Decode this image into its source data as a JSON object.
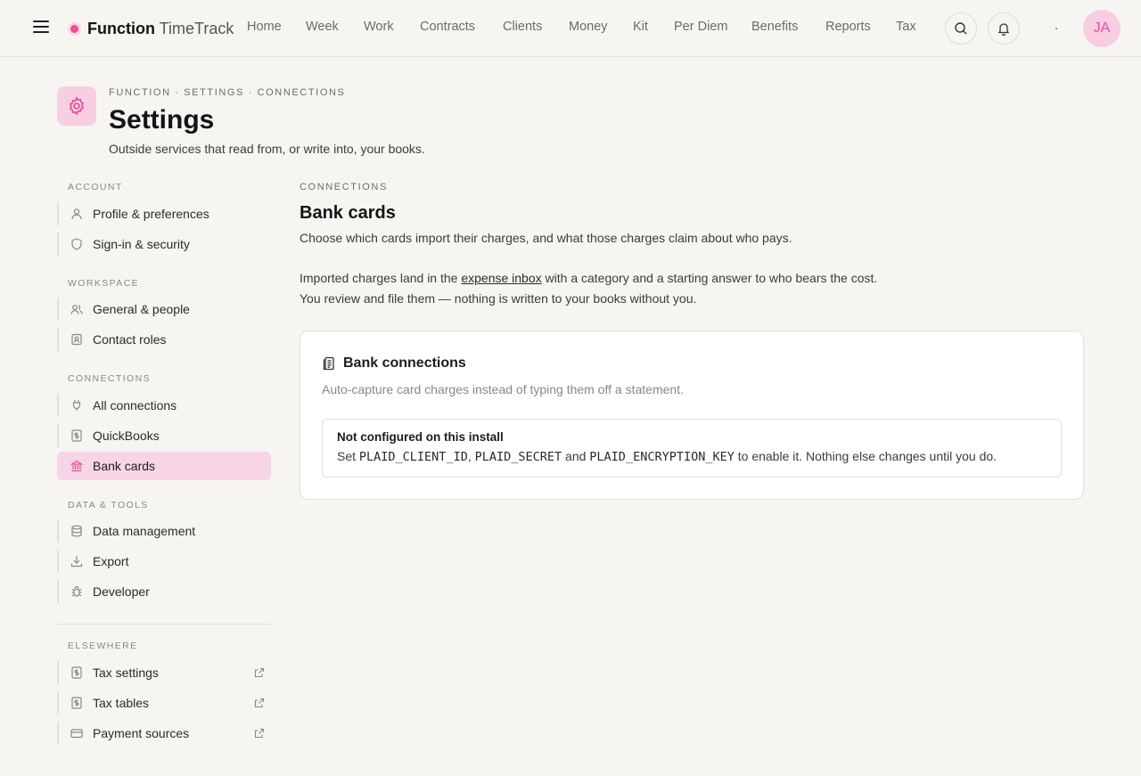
{
  "brand": {
    "name": "Function",
    "product": "TimeTrack",
    "accent": "#ec4f9a"
  },
  "nav": [
    "Home",
    "Week",
    "Work",
    "Contracts",
    "Clients",
    "Money",
    "Kit",
    "Per Diem",
    "Benefits",
    "Reports",
    "Tax"
  ],
  "topbar": {
    "search_icon": "search-icon",
    "bell_icon": "bell-icon",
    "avatar_initials": "JA"
  },
  "header": {
    "breadcrumb": "FUNCTION · SETTINGS · CONNECTIONS",
    "title": "Settings",
    "subtitle": "Outside services that read from, or write into, your books.",
    "icon": "gear-icon"
  },
  "sidebar": {
    "sections": [
      {
        "label": "ACCOUNT",
        "items": [
          {
            "label": "Profile & preferences",
            "icon": "user-icon"
          },
          {
            "label": "Sign-in & security",
            "icon": "shield-icon"
          }
        ]
      },
      {
        "label": "WORKSPACE",
        "items": [
          {
            "label": "General & people",
            "icon": "users-icon"
          },
          {
            "label": "Contact roles",
            "icon": "contact-card-icon"
          }
        ]
      },
      {
        "label": "CONNECTIONS",
        "items": [
          {
            "label": "All connections",
            "icon": "plug-icon"
          },
          {
            "label": "QuickBooks",
            "icon": "dollar-doc-icon"
          },
          {
            "label": "Bank cards",
            "icon": "bank-icon",
            "active": true
          }
        ]
      },
      {
        "label": "DATA & TOOLS",
        "items": [
          {
            "label": "Data management",
            "icon": "database-icon"
          },
          {
            "label": "Export",
            "icon": "download-icon"
          },
          {
            "label": "Developer",
            "icon": "bug-icon"
          }
        ]
      },
      {
        "label": "ELSEWHERE",
        "items": [
          {
            "label": "Tax settings",
            "icon": "dollar-doc-icon",
            "external": true
          },
          {
            "label": "Tax tables",
            "icon": "dollar-doc-icon",
            "external": true
          },
          {
            "label": "Payment sources",
            "icon": "credit-card-icon",
            "external": true
          }
        ]
      }
    ]
  },
  "main": {
    "section_label": "CONNECTIONS",
    "title": "Bank cards",
    "description": "Choose which cards import their charges, and what those charges claim about who pays.",
    "para1_before": "Imported charges land in the ",
    "para1_link": "expense inbox",
    "para1_after": " with a category and a starting answer to who bears the cost.",
    "para2": "You review and file them — nothing is written to your books without you."
  },
  "card": {
    "title": "Bank connections",
    "description": "Auto-capture card charges instead of typing them off a statement.",
    "notice_title": "Not configured on this install",
    "notice_set": "Set ",
    "key1": "PLAID_CLIENT_ID",
    "sep1": ", ",
    "key2": "PLAID_SECRET",
    "sep2": " and ",
    "key3": "PLAID_ENCRYPTION_KEY",
    "notice_tail": " to enable it. Nothing else changes until you do."
  }
}
